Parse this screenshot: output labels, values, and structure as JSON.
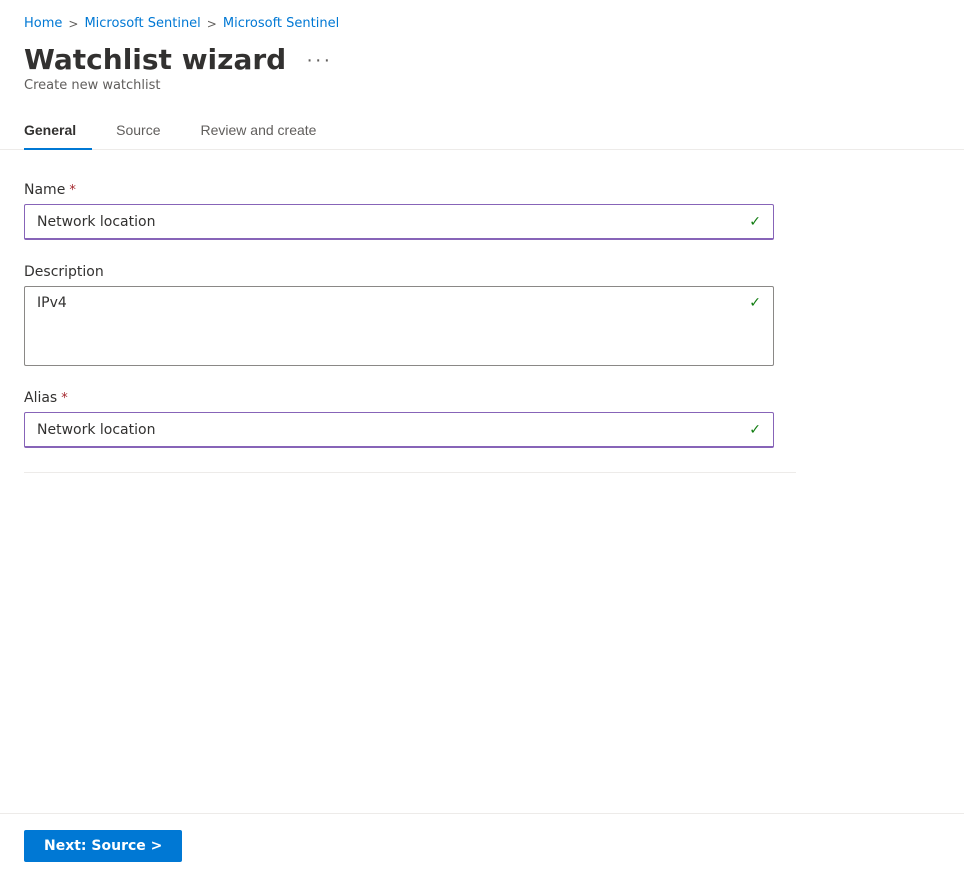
{
  "breadcrumb": {
    "items": [
      {
        "label": "Home",
        "href": "#"
      },
      {
        "label": "Microsoft Sentinel",
        "href": "#"
      },
      {
        "label": "Microsoft Sentinel",
        "href": "#"
      }
    ],
    "separators": [
      ">",
      ">",
      ">"
    ]
  },
  "header": {
    "title": "Watchlist wizard",
    "more_menu_label": "···",
    "subtitle": "Create new watchlist"
  },
  "tabs": [
    {
      "label": "General",
      "active": true
    },
    {
      "label": "Source",
      "active": false
    },
    {
      "label": "Review and create",
      "active": false
    }
  ],
  "form": {
    "name_label": "Name",
    "name_required": "*",
    "name_value": "Network location",
    "description_label": "Description",
    "description_value": "IPv4",
    "alias_label": "Alias",
    "alias_required": "*",
    "alias_value": "Network location",
    "check_symbol": "✓"
  },
  "footer": {
    "next_button_label": "Next: Source >"
  }
}
